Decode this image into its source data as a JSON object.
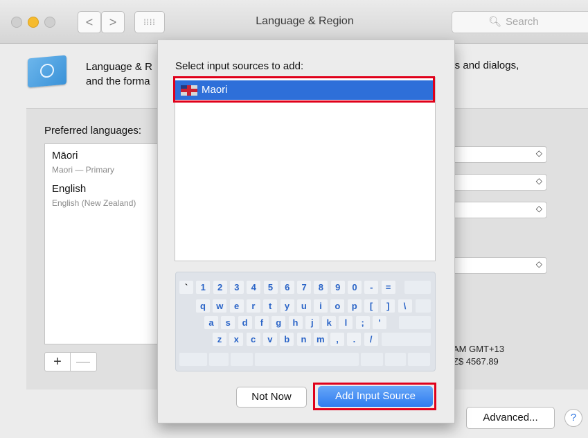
{
  "window": {
    "title": "Language & Region",
    "search_placeholder": "Search",
    "search_icon": "magnifier-icon",
    "nav_back": "<",
    "nav_forward": ">",
    "grid_glyph": "⁞⁞⁞⁞"
  },
  "background": {
    "description_line1": "Language & R",
    "description_line2": "and the forma",
    "description_right": "nus and dialogs,",
    "preferred_label": "Preferred languages:",
    "languages": [
      {
        "name": "Māori",
        "detail": "Maori — Primary"
      },
      {
        "name": "English",
        "detail": "English (New Zealand)"
      }
    ],
    "plus_label": "+",
    "minus_label": "—",
    "time_text": "AM GMT+13",
    "currency_text": "Z$ 4567.89",
    "advanced_label": "Advanced...",
    "help_label": "?",
    "popup_chevron": "◇"
  },
  "sheet": {
    "title": "Select input sources to add:",
    "selected_source": "Maori",
    "keyboard_rows": [
      [
        "`",
        "1",
        "2",
        "3",
        "4",
        "5",
        "6",
        "7",
        "8",
        "9",
        "0",
        "-",
        "="
      ],
      [
        "q",
        "w",
        "e",
        "r",
        "t",
        "y",
        "u",
        "i",
        "o",
        "p",
        "[",
        "]",
        "\\"
      ],
      [
        "a",
        "s",
        "d",
        "f",
        "g",
        "h",
        "j",
        "k",
        "l",
        ";",
        "'"
      ],
      [
        "z",
        "x",
        "c",
        "v",
        "b",
        "n",
        "m",
        ",",
        ".",
        "/"
      ]
    ],
    "not_now_label": "Not Now",
    "add_label": "Add Input Source"
  },
  "colors": {
    "selection": "#2e6fd9",
    "highlight_outline": "#e0001a",
    "key_text": "#2a64c7"
  }
}
